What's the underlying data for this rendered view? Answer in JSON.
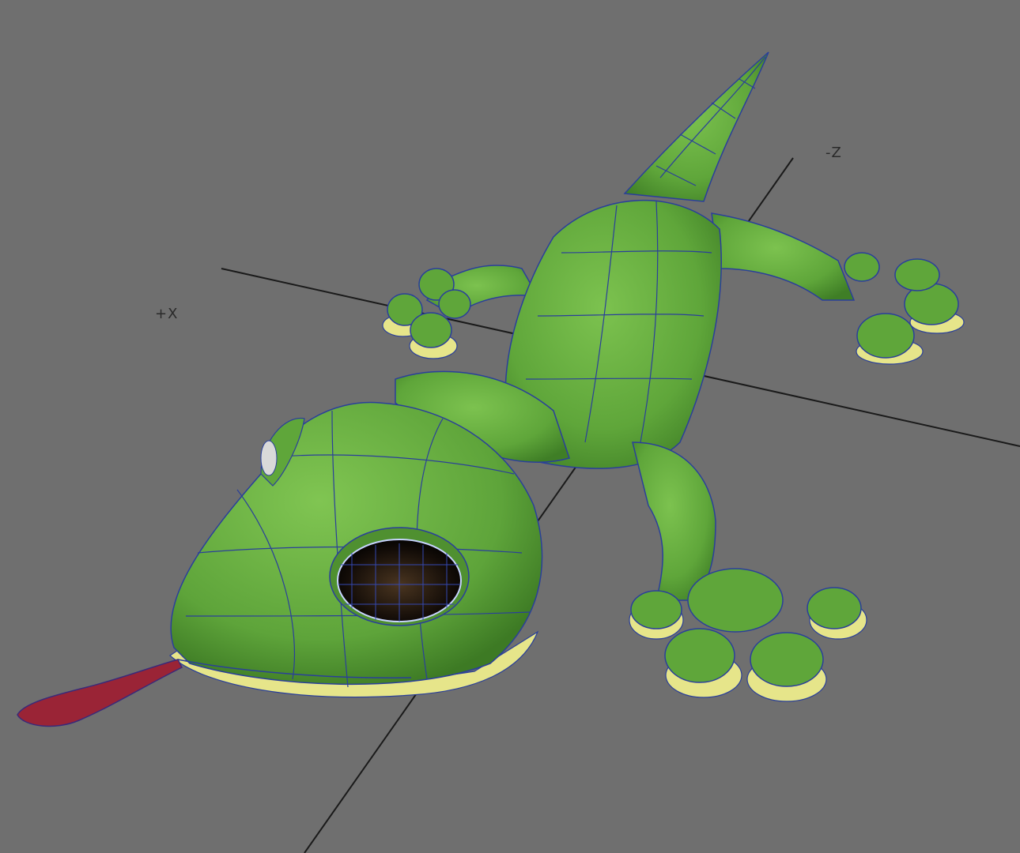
{
  "viewport": {
    "background": "#6f6f6f",
    "axes": {
      "x_label": "+X",
      "z_label": "-Z"
    },
    "model": {
      "subject": "gecko",
      "body_color": "#5fa63a",
      "belly_color": "#e6e58a",
      "wireframe_color": "#2a3f9a",
      "tongue_color": "#9a2436"
    }
  }
}
